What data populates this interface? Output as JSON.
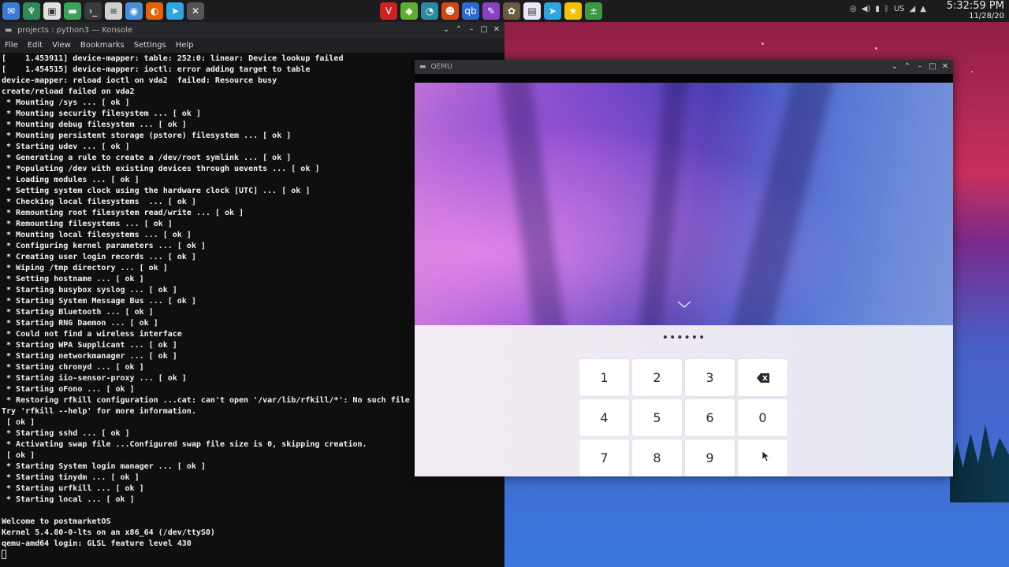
{
  "panel": {
    "apps": [
      {
        "icon": "mail-icon",
        "color": "#3a7bd5",
        "glyph": "✉"
      },
      {
        "icon": "kde-connect-icon",
        "color": "#2e8b57",
        "glyph": "♆"
      },
      {
        "icon": "store-icon",
        "color": "#e0e0e0",
        "glyph": "▣"
      },
      {
        "icon": "folder-icon",
        "color": "#3aa35a",
        "glyph": "▬"
      },
      {
        "icon": "terminal-icon",
        "color": "#3a3a3a",
        "glyph": "›_"
      },
      {
        "icon": "file-manager-icon",
        "color": "#d0d0d0",
        "glyph": "≡"
      },
      {
        "icon": "globe-icon",
        "color": "#4a90d9",
        "glyph": "◉"
      },
      {
        "icon": "firefox-icon",
        "color": "#e66000",
        "glyph": "◐"
      },
      {
        "icon": "telegram-icon",
        "color": "#2ca5e0",
        "glyph": "➤"
      },
      {
        "icon": "close-window-icon",
        "color": "#555555",
        "glyph": "✕"
      }
    ],
    "tasks": [
      {
        "icon": "vivaldi-icon",
        "color": "#c22",
        "glyph": "V"
      },
      {
        "icon": "cube-icon",
        "color": "#5bb030",
        "glyph": "◆"
      },
      {
        "icon": "gauge-icon",
        "color": "#2a8aa0",
        "glyph": "◔"
      },
      {
        "icon": "robot-icon",
        "color": "#d04a10",
        "glyph": "☻"
      },
      {
        "icon": "qbittorrent-icon",
        "color": "#2a6ad0",
        "glyph": "qb"
      },
      {
        "icon": "color-picker-icon",
        "color": "#8a40c0",
        "glyph": "✎"
      },
      {
        "icon": "gimp-icon",
        "color": "#6a5a40",
        "glyph": "✿"
      },
      {
        "icon": "document-icon",
        "color": "#e8e8f8",
        "glyph": "▤"
      },
      {
        "icon": "telegram-task-icon",
        "color": "#2ca5e0",
        "glyph": "➤"
      },
      {
        "icon": "star-icon",
        "color": "#f2c200",
        "glyph": "★"
      },
      {
        "icon": "calculator-icon",
        "color": "#3a9a40",
        "glyph": "±"
      }
    ],
    "tray": [
      {
        "icon": "record-icon",
        "glyph": "◎"
      },
      {
        "icon": "volume-icon",
        "glyph": "◀)"
      },
      {
        "icon": "battery-icon",
        "glyph": "▮"
      },
      {
        "icon": "bluetooth-icon",
        "glyph": "ᛒ"
      },
      {
        "icon": "keyboard-layout-icon",
        "glyph": "US"
      },
      {
        "icon": "wifi-icon",
        "glyph": "◢"
      },
      {
        "icon": "tray-expand-icon",
        "glyph": "▲"
      }
    ],
    "time": "5:32:59 PM",
    "date": "11/28/20"
  },
  "konsole": {
    "title": "projects : python3 — Konsole",
    "menu": [
      "File",
      "Edit",
      "View",
      "Bookmarks",
      "Settings",
      "Help"
    ],
    "lines": [
      "[    1.453911] device-mapper: table: 252:0: linear: Device lookup failed",
      "[    1.454515] device-mapper: ioctl: error adding target to table",
      "device-mapper: reload ioctl on vda2  failed: Resource busy",
      "create/reload failed on vda2",
      " * Mounting /sys ... [ ok ]",
      " * Mounting security filesystem ... [ ok ]",
      " * Mounting debug filesystem ... [ ok ]",
      " * Mounting persistent storage (pstore) filesystem ... [ ok ]",
      " * Starting udev ... [ ok ]",
      " * Generating a rule to create a /dev/root symlink ... [ ok ]",
      " * Populating /dev with existing devices through uevents ... [ ok ]",
      " * Loading modules ... [ ok ]",
      " * Setting system clock using the hardware clock [UTC] ... [ ok ]",
      " * Checking local filesystems  ... [ ok ]",
      " * Remounting root filesystem read/write ... [ ok ]",
      " * Remounting filesystems ... [ ok ]",
      " * Mounting local filesystems ... [ ok ]",
      " * Configuring kernel parameters ... [ ok ]",
      " * Creating user login records ... [ ok ]",
      " * Wiping /tmp directory ... [ ok ]",
      " * Setting hostname ... [ ok ]",
      " * Starting busybox syslog ... [ ok ]",
      " * Starting System Message Bus ... [ ok ]",
      " * Starting Bluetooth ... [ ok ]",
      " * Starting RNG Daemon ... [ ok ]",
      " * Could not find a wireless interface",
      " * Starting WPA Supplicant ... [ ok ]",
      " * Starting networkmanager ... [ ok ]",
      " * Starting chronyd ... [ ok ]",
      " * Starting iio-sensor-proxy ... [ ok ]",
      " * Starting oFono ... [ ok ]",
      " * Restoring rfkill configuration ...cat: can't open '/var/lib/rfkill/*': No such file o",
      "Try 'rfkill --help' for more information.",
      " [ ok ]",
      " * Starting sshd ... [ ok ]",
      " * Activating swap file ...Configured swap file size is 0, skipping creation.",
      " [ ok ]",
      " * Starting System login manager ... [ ok ]",
      " * Starting tinydm ... [ ok ]",
      " * Starting urfkill ... [ ok ]",
      " * Starting local ... [ ok ]",
      "",
      "Welcome to postmarketOS",
      "Kernel 5.4.80-0-lts on an x86_64 (/dev/ttyS0)",
      "qemu-amd64 login: GLSL feature level 430"
    ]
  },
  "qemu": {
    "title": "QEMU",
    "pin_dots": "••••••",
    "keys": [
      {
        "label": "1",
        "icon": ""
      },
      {
        "label": "2",
        "icon": ""
      },
      {
        "label": "3",
        "icon": ""
      },
      {
        "label": "",
        "icon": "backspace-icon"
      },
      {
        "label": "4",
        "icon": ""
      },
      {
        "label": "5",
        "icon": ""
      },
      {
        "label": "6",
        "icon": ""
      },
      {
        "label": "0",
        "icon": ""
      },
      {
        "label": "7",
        "icon": ""
      },
      {
        "label": "8",
        "icon": ""
      },
      {
        "label": "9",
        "icon": ""
      },
      {
        "label": "",
        "icon": "enter-icon"
      }
    ]
  }
}
